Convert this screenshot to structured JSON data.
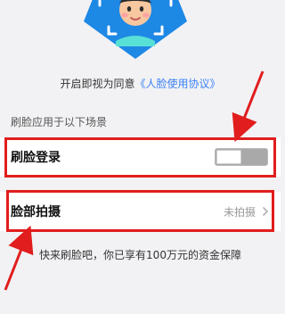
{
  "consent": {
    "prefix": "开启即视为同意",
    "link": "《人脸使用协议》"
  },
  "section": {
    "label": "刷脸应用于以下场景"
  },
  "rows": {
    "face_login": {
      "title": "刷脸登录",
      "toggle_state": "off"
    },
    "face_photo": {
      "title": "脸部拍摄",
      "status": "未拍摄"
    }
  },
  "promo": {
    "text": "快来刷脸吧，你已享有100万元的资金保障"
  },
  "colors": {
    "accent_blue": "#3b82f6",
    "annotation_red": "#e11d1d",
    "page_bg": "#f2f2f4",
    "row_bg": "#ffffff"
  },
  "icons": {
    "hero": "face-scan-badge-icon",
    "chevron": "chevron-right-icon"
  }
}
